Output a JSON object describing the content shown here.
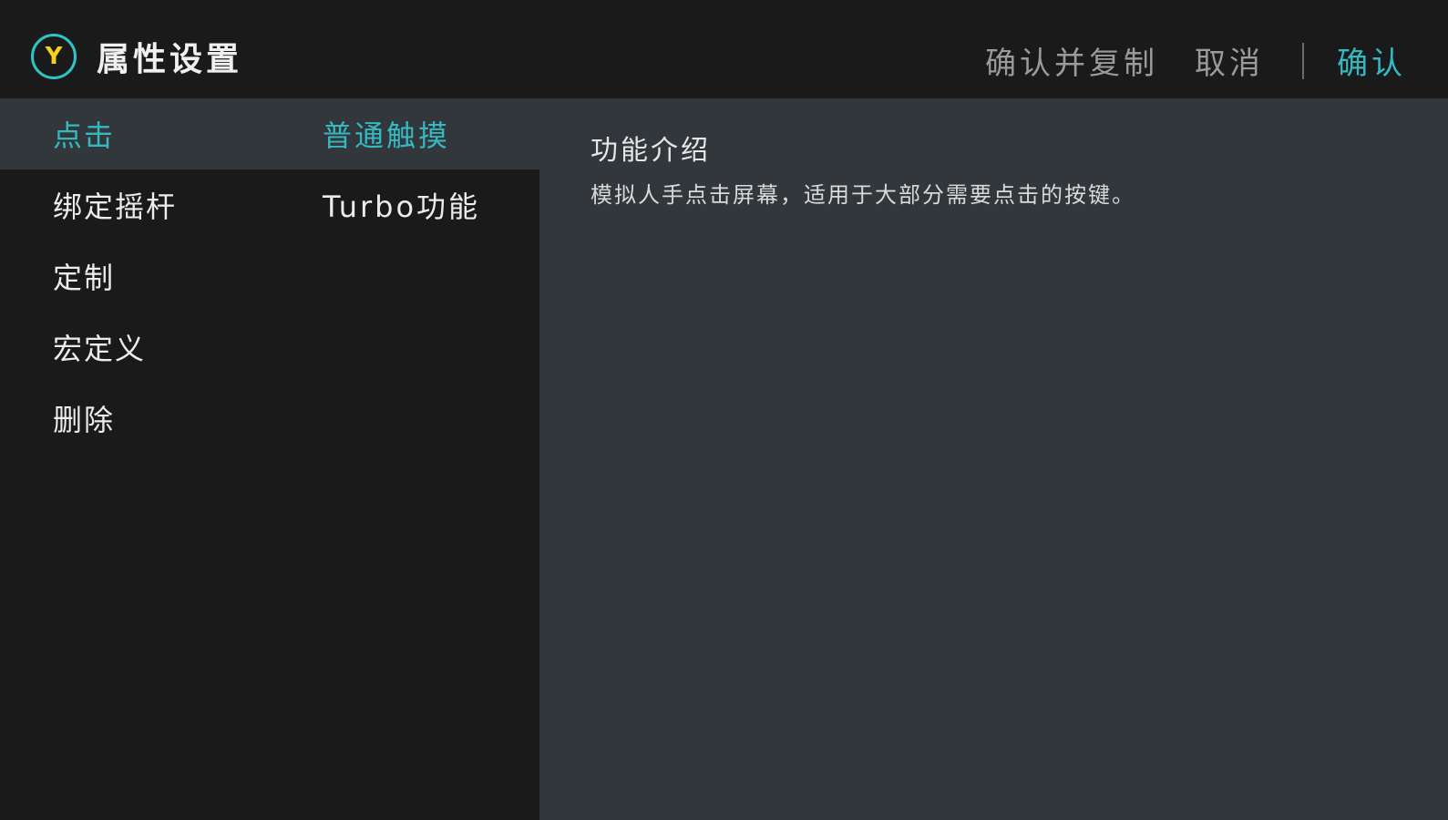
{
  "header": {
    "logo_letter": "Y",
    "title": "属性设置",
    "actions": {
      "confirm_copy": "确认并复制",
      "cancel": "取消",
      "confirm": "确认"
    }
  },
  "categories": [
    {
      "label": "点击",
      "active": true
    },
    {
      "label": "绑定摇杆",
      "active": false
    },
    {
      "label": "定制",
      "active": false
    },
    {
      "label": "宏定义",
      "active": false
    },
    {
      "label": "删除",
      "active": false
    }
  ],
  "subtypes": [
    {
      "label": "普通触摸",
      "active": true
    },
    {
      "label": "Turbo功能",
      "active": false
    }
  ],
  "detail": {
    "title": "功能介绍",
    "description": "模拟人手点击屏幕，适用于大部分需要点击的按键。"
  },
  "colors": {
    "accent": "#35b9c0",
    "logo_ring": "#2ec4c4",
    "logo_letter": "#f2d21b",
    "panel_bg": "#32373c",
    "app_bg": "#1a1a1b"
  }
}
